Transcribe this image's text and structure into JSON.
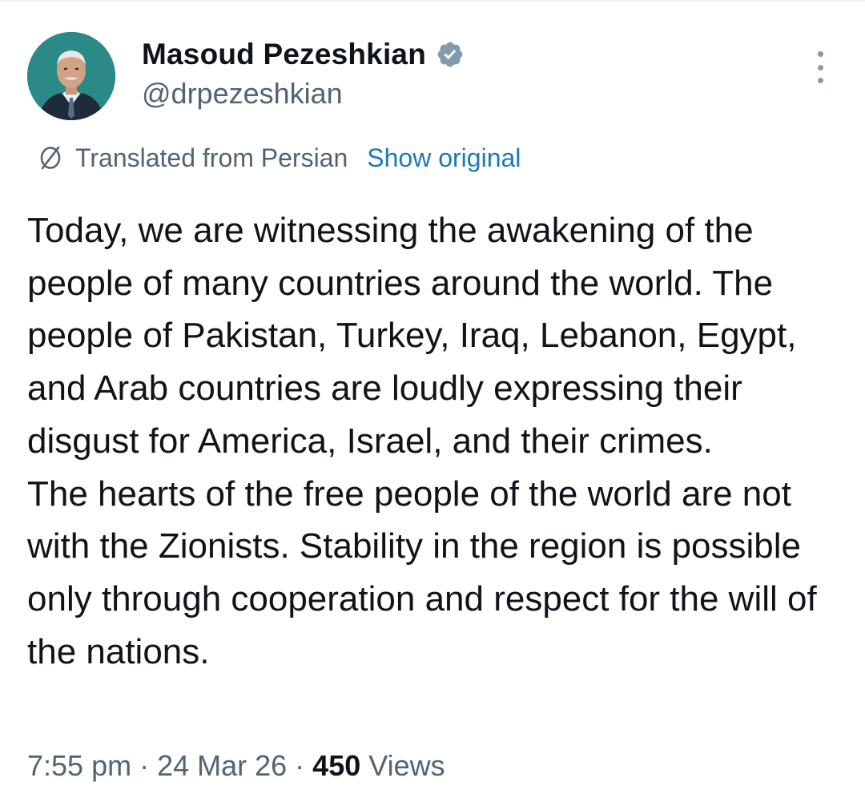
{
  "user": {
    "display_name": "Masoud Pezeshkian",
    "handle": "@drpezeshkian",
    "verified": true
  },
  "translation": {
    "label": "Translated from Persian",
    "show_original": "Show original"
  },
  "tweet": {
    "text": "Today, we are witnessing the awakening of the people of many countries around the world. The people of Pakistan, Turkey, Iraq, Lebanon, Egypt, and Arab countries are loudly expressing their disgust for America, Israel, and their crimes.\nThe hearts of the free people of the world are not with the Zionists. Stability in the region is possible only through cooperation and respect for the will of the nations."
  },
  "meta": {
    "time": "7:55 pm",
    "separator": "·",
    "date": "24 Mar 26",
    "views_count": "450",
    "views_label": "Views"
  },
  "colors": {
    "text": "#0f1419",
    "secondary": "#536471",
    "link": "#1d78b8",
    "badge": "#829aab",
    "avatar_bg": "#2f8c8a"
  },
  "icons": {
    "verified": "verified-badge-icon",
    "translate": "translate-icon",
    "more": "more-options-icon"
  }
}
